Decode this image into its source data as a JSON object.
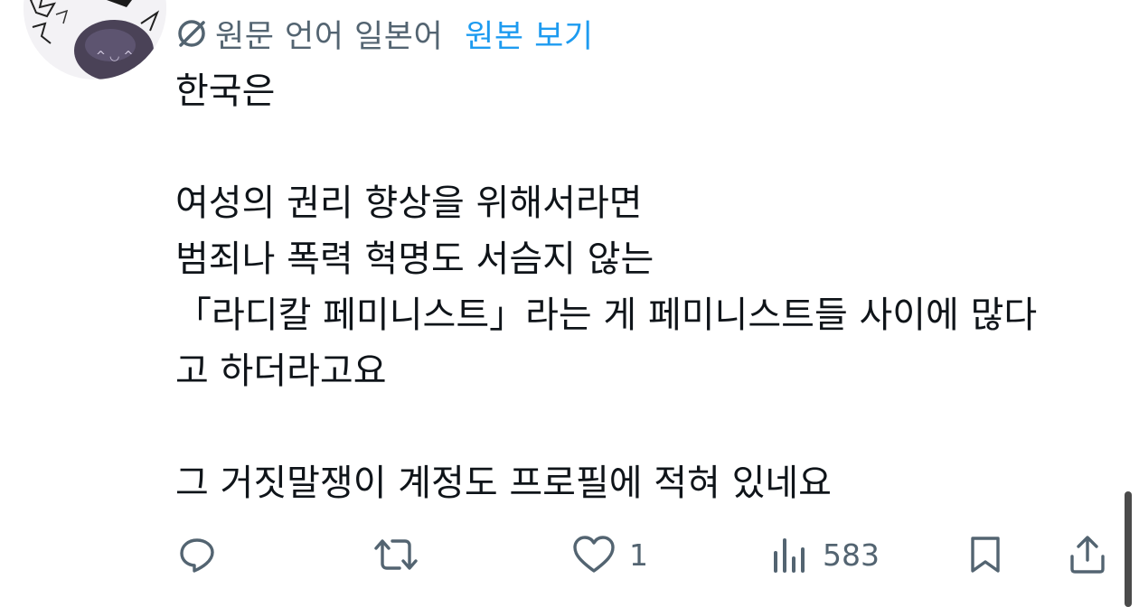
{
  "translation": {
    "label": "원문 언어 일본어",
    "show_original": "원본 보기"
  },
  "tweet": {
    "lines": [
      "한국은",
      "",
      "여성의 권리 향상을 위해서라면",
      "범죄나 폭력 혁명도 서슴지 않는",
      "「라디칼 페미니스트」라는 게 페미니스트들 사이에 많다",
      "고 하더라고요",
      "",
      "그 거짓말쟁이 계정도 프로필에 적혀 있네요"
    ]
  },
  "actions": {
    "reply": {
      "icon": "reply-icon"
    },
    "retweet": {
      "icon": "retweet-icon"
    },
    "like": {
      "icon": "heart-icon",
      "count": "1"
    },
    "views": {
      "icon": "views-icon",
      "count": "583"
    },
    "bookmark": {
      "icon": "bookmark-icon"
    },
    "share": {
      "icon": "share-icon"
    }
  },
  "colors": {
    "text": "#0f1419",
    "secondary": "#536471",
    "link": "#1d9bf0"
  }
}
